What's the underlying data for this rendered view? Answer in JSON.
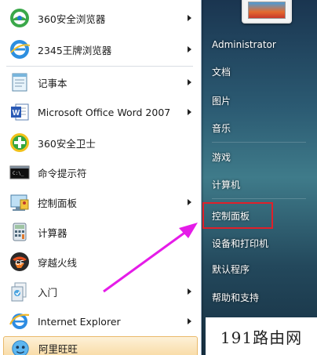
{
  "start_menu": {
    "programs": [
      {
        "label": "360安全浏览器",
        "icon": "360-browser-icon",
        "has_submenu": true
      },
      {
        "label": "2345王牌浏览器",
        "icon": "2345-browser-icon",
        "has_submenu": true
      },
      {
        "label": "记事本",
        "icon": "notepad-icon",
        "has_submenu": true
      },
      {
        "label": "Microsoft Office Word 2007",
        "icon": "word-icon",
        "has_submenu": true
      },
      {
        "label": "360安全卫士",
        "icon": "360-safeguard-icon",
        "has_submenu": false
      },
      {
        "label": "命令提示符",
        "icon": "cmd-icon",
        "has_submenu": false
      },
      {
        "label": "控制面板",
        "icon": "control-panel-icon",
        "has_submenu": true
      },
      {
        "label": "计算器",
        "icon": "calculator-icon",
        "has_submenu": false
      },
      {
        "label": "穿越火线",
        "icon": "crossfire-icon",
        "has_submenu": false
      },
      {
        "label": "入门",
        "icon": "getting-started-icon",
        "has_submenu": true
      },
      {
        "label": "Internet Explorer",
        "icon": "ie-icon",
        "has_submenu": true
      },
      {
        "label": "阿里旺旺",
        "icon": "aliwangwang-icon",
        "has_submenu": false,
        "highlighted": true
      }
    ],
    "places": {
      "user": "Administrator",
      "items": [
        {
          "label": "文档"
        },
        {
          "label": "图片"
        },
        {
          "label": "音乐"
        },
        {
          "label": "游戏"
        },
        {
          "label": "计算机"
        },
        {
          "label": "控制面板",
          "boxed": true
        },
        {
          "label": "设备和打印机"
        },
        {
          "label": "默认程序"
        },
        {
          "label": "帮助和支持"
        }
      ]
    },
    "watermark": "191路由网",
    "colors": {
      "highlight_box": "#e0202a",
      "pointer_arrow": "#e51ce8"
    }
  }
}
